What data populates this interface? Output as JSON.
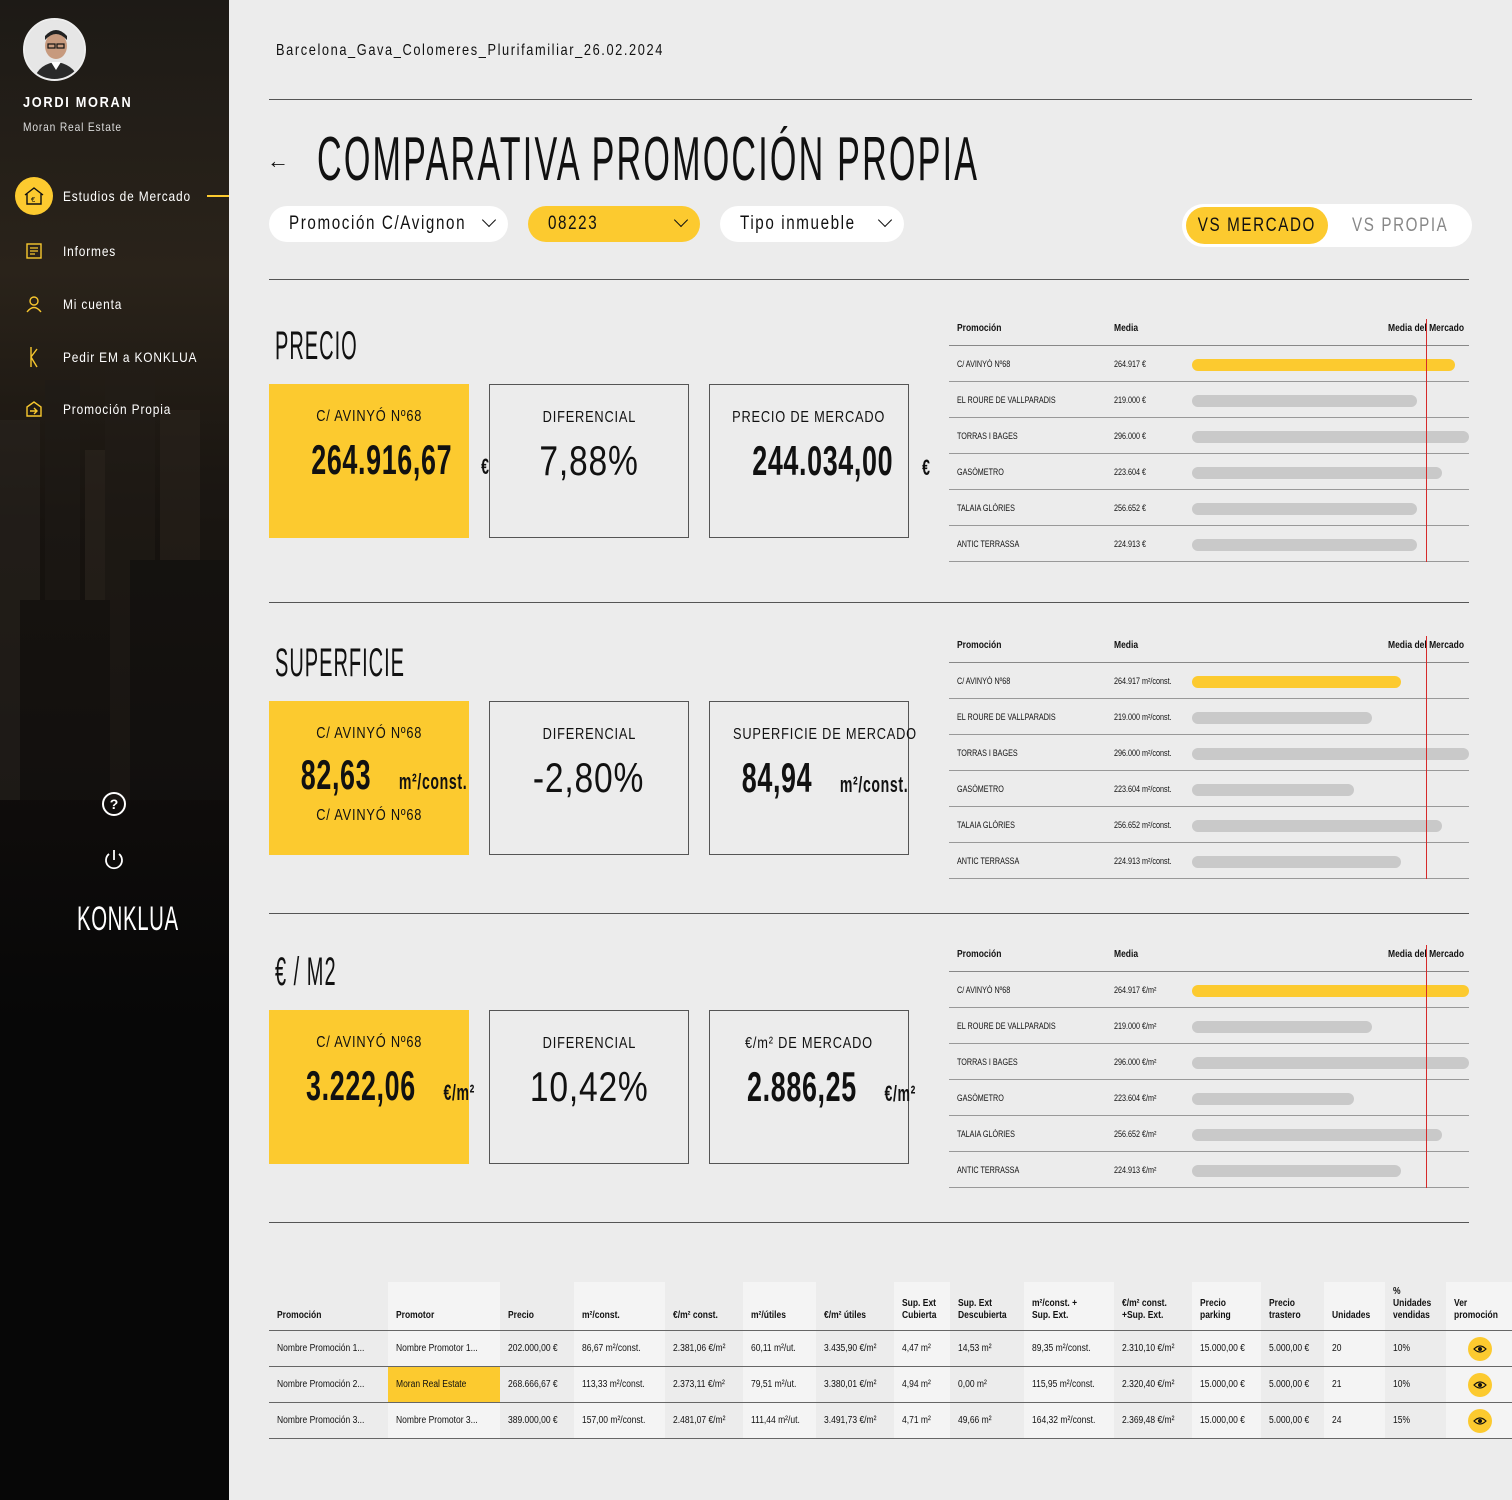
{
  "user": {
    "name": "JORDI MORAN",
    "company": "Moran Real Estate"
  },
  "nav": [
    {
      "label": "Estudios de Mercado",
      "icon": "market-study-icon"
    },
    {
      "label": "Informes",
      "icon": "report-icon"
    },
    {
      "label": "Mi cuenta",
      "icon": "user-icon"
    },
    {
      "label": "Pedir EM a KONKLUA",
      "icon": "konklua-k-icon"
    },
    {
      "label": "Promoción Propia",
      "icon": "own-promotion-icon"
    }
  ],
  "brand": "KONKLUA",
  "file_title": "Barcelona_Gava_Colomeres_Plurifamiliar_26.02.2024",
  "page_title": "COMPARATIVA PROMOCIÓN PROPIA",
  "filters": {
    "promotion": "Promoción C/Avignon",
    "postal_code": "08223",
    "property_type": "Tipo inmueble"
  },
  "toggle": {
    "market": "VS MERCADO",
    "own": "VS PROPIA"
  },
  "colors": {
    "accent": "#fcca2f",
    "market_line": "#d62a2a",
    "bar_grey": "#c9c9c9"
  },
  "sections": {
    "precio": {
      "title": "PRECIO",
      "own": {
        "label": "C/ AVINYÓ Nº68",
        "value": "264.916,67",
        "unit": "€"
      },
      "diff": {
        "label": "DIFERENCIAL",
        "value": "7,88%"
      },
      "market": {
        "label": "PRECIO DE MERCADO",
        "value": "244.034,00",
        "unit": "€"
      },
      "table": {
        "headers": {
          "name": "Promoción",
          "avg": "Media",
          "market": "Media del Mercado"
        },
        "market_fraction": 0.845,
        "rows": [
          {
            "name": "C/ AVINYÓ Nº68",
            "value": "264.917 €",
            "fraction": 0.948,
            "highlight": true
          },
          {
            "name": "EL ROURE DE VALLPARADIS",
            "value": "219.000 €",
            "fraction": 0.814
          },
          {
            "name": "TORRAS I BAGES",
            "value": "296.000 €",
            "fraction": 1.0
          },
          {
            "name": "GASÓMETRO",
            "value": "223.604 €",
            "fraction": 0.901
          },
          {
            "name": "TALAIA GLÒRIES",
            "value": "256.652 €",
            "fraction": 0.814
          },
          {
            "name": "ANTIC TERRASSA",
            "value": "224.913 €",
            "fraction": 0.814
          }
        ]
      }
    },
    "superficie": {
      "title": "SUPERFICIE",
      "own": {
        "label": "C/ AVINYÓ Nº68",
        "value": "82,63",
        "unit": "m²/const.",
        "sub": "C/ AVINYÓ Nº68"
      },
      "diff": {
        "label": "DIFERENCIAL",
        "value": "-2,80%"
      },
      "market": {
        "label": "SUPERFICIE DE MERCADO",
        "value": "84,94",
        "unit": "m²/const."
      },
      "table": {
        "headers": {
          "name": "Promoción",
          "avg": "Media",
          "market": "Media del Mercado"
        },
        "market_fraction": 0.845,
        "rows": [
          {
            "name": "C/ AVINYÓ Nº68",
            "value": "264.917 m²/const.",
            "fraction": 0.753,
            "highlight": true
          },
          {
            "name": "EL ROURE DE VALLPARADIS",
            "value": "219.000 m²/const.",
            "fraction": 0.651
          },
          {
            "name": "TORRAS I BAGES",
            "value": "296.000 m²/const.",
            "fraction": 1.0
          },
          {
            "name": "GASÓMETRO",
            "value": "223.604 m²/const.",
            "fraction": 0.585
          },
          {
            "name": "TALAIA GLÒRIES",
            "value": "256.652 m²/const.",
            "fraction": 0.901
          },
          {
            "name": "ANTIC TERRASSA",
            "value": "224.913 m²/const.",
            "fraction": 0.753
          }
        ]
      }
    },
    "eurm2": {
      "title": "€ / M2",
      "own": {
        "label": "C/ AVINYÓ Nº68",
        "value": "3.222,06",
        "unit": "€/m²"
      },
      "diff": {
        "label": "DIFERENCIAL",
        "value": "10,42%"
      },
      "market": {
        "label": "€/m² DE MERCADO",
        "value": "2.886,25",
        "unit": "€/m²"
      },
      "table": {
        "headers": {
          "name": "Promoción",
          "avg": "Media",
          "market": "Media del Mercado"
        },
        "market_fraction": 0.845,
        "rows": [
          {
            "name": "C/ AVINYÓ Nº68",
            "value": "264.917 €/m²",
            "fraction": 1.0,
            "highlight": true
          },
          {
            "name": "EL ROURE DE VALLPARADIS",
            "value": "219.000 €/m²",
            "fraction": 0.651
          },
          {
            "name": "TORRAS I BAGES",
            "value": "296.000 €/m²",
            "fraction": 1.0
          },
          {
            "name": "GASÓMETRO",
            "value": "223.604 €/m²",
            "fraction": 0.585
          },
          {
            "name": "TALAIA GLÒRIES",
            "value": "256.652 €/m²",
            "fraction": 0.901
          },
          {
            "name": "ANTIC TERRASSA",
            "value": "224.913 €/m²",
            "fraction": 0.753
          }
        ]
      }
    }
  },
  "data_table": {
    "headers": [
      "Promoción",
      "Promotor",
      "Precio",
      "m²/const.",
      "€/m² const.",
      "m²/útiles",
      "€/m² útiles",
      "Sup. Ext Cubierta",
      "Sup. Ext Descubierta",
      "m²/const. + Sup. Ext.",
      "€/m² const. +Sup. Ext.",
      "Precio parking",
      "Precio trastero",
      "Unidades",
      "% Unidades vendidas",
      "Ver promoción"
    ],
    "rows": [
      {
        "cells": [
          "Nombre Promoción 1...",
          "Nombre Promotor 1...",
          "202.000,00 €",
          "86,67 m²/const.",
          "2.381,06 €/m²",
          "60,11 m²/ut.",
          "3.435,90 €/m²",
          "4,47 m²",
          "14,53 m²",
          "89,35 m²/const.",
          "2.310,10 €/m²",
          "15.000,00 €",
          "5.000,00 €",
          "20",
          "10%"
        ],
        "highlight_promotor": false
      },
      {
        "cells": [
          "Nombre Promoción 2...",
          "Moran Real Estate",
          "268.666,67 €",
          "113,33 m²/const.",
          "2.373,11 €/m²",
          "79,51 m²/ut.",
          "3.380,01 €/m²",
          "4,94 m²",
          "0,00 m²",
          "115,95 m²/const.",
          "2.320,40 €/m²",
          "15.000,00 €",
          "5.000,00 €",
          "21",
          "10%"
        ],
        "highlight_promotor": true
      },
      {
        "cells": [
          "Nombre Promoción 3...",
          "Nombre Promotor 3...",
          "389.000,00 €",
          "157,00 m²/const.",
          "2.481,07 €/m²",
          "111,44 m²/ut.",
          "3.491,73 €/m²",
          "4,71 m²",
          "49,66 m²",
          "164,32 m²/const.",
          "2.369,48 €/m²",
          "15.000,00 €",
          "5.000,00 €",
          "24",
          "15%"
        ],
        "highlight_promotor": false
      }
    ]
  }
}
